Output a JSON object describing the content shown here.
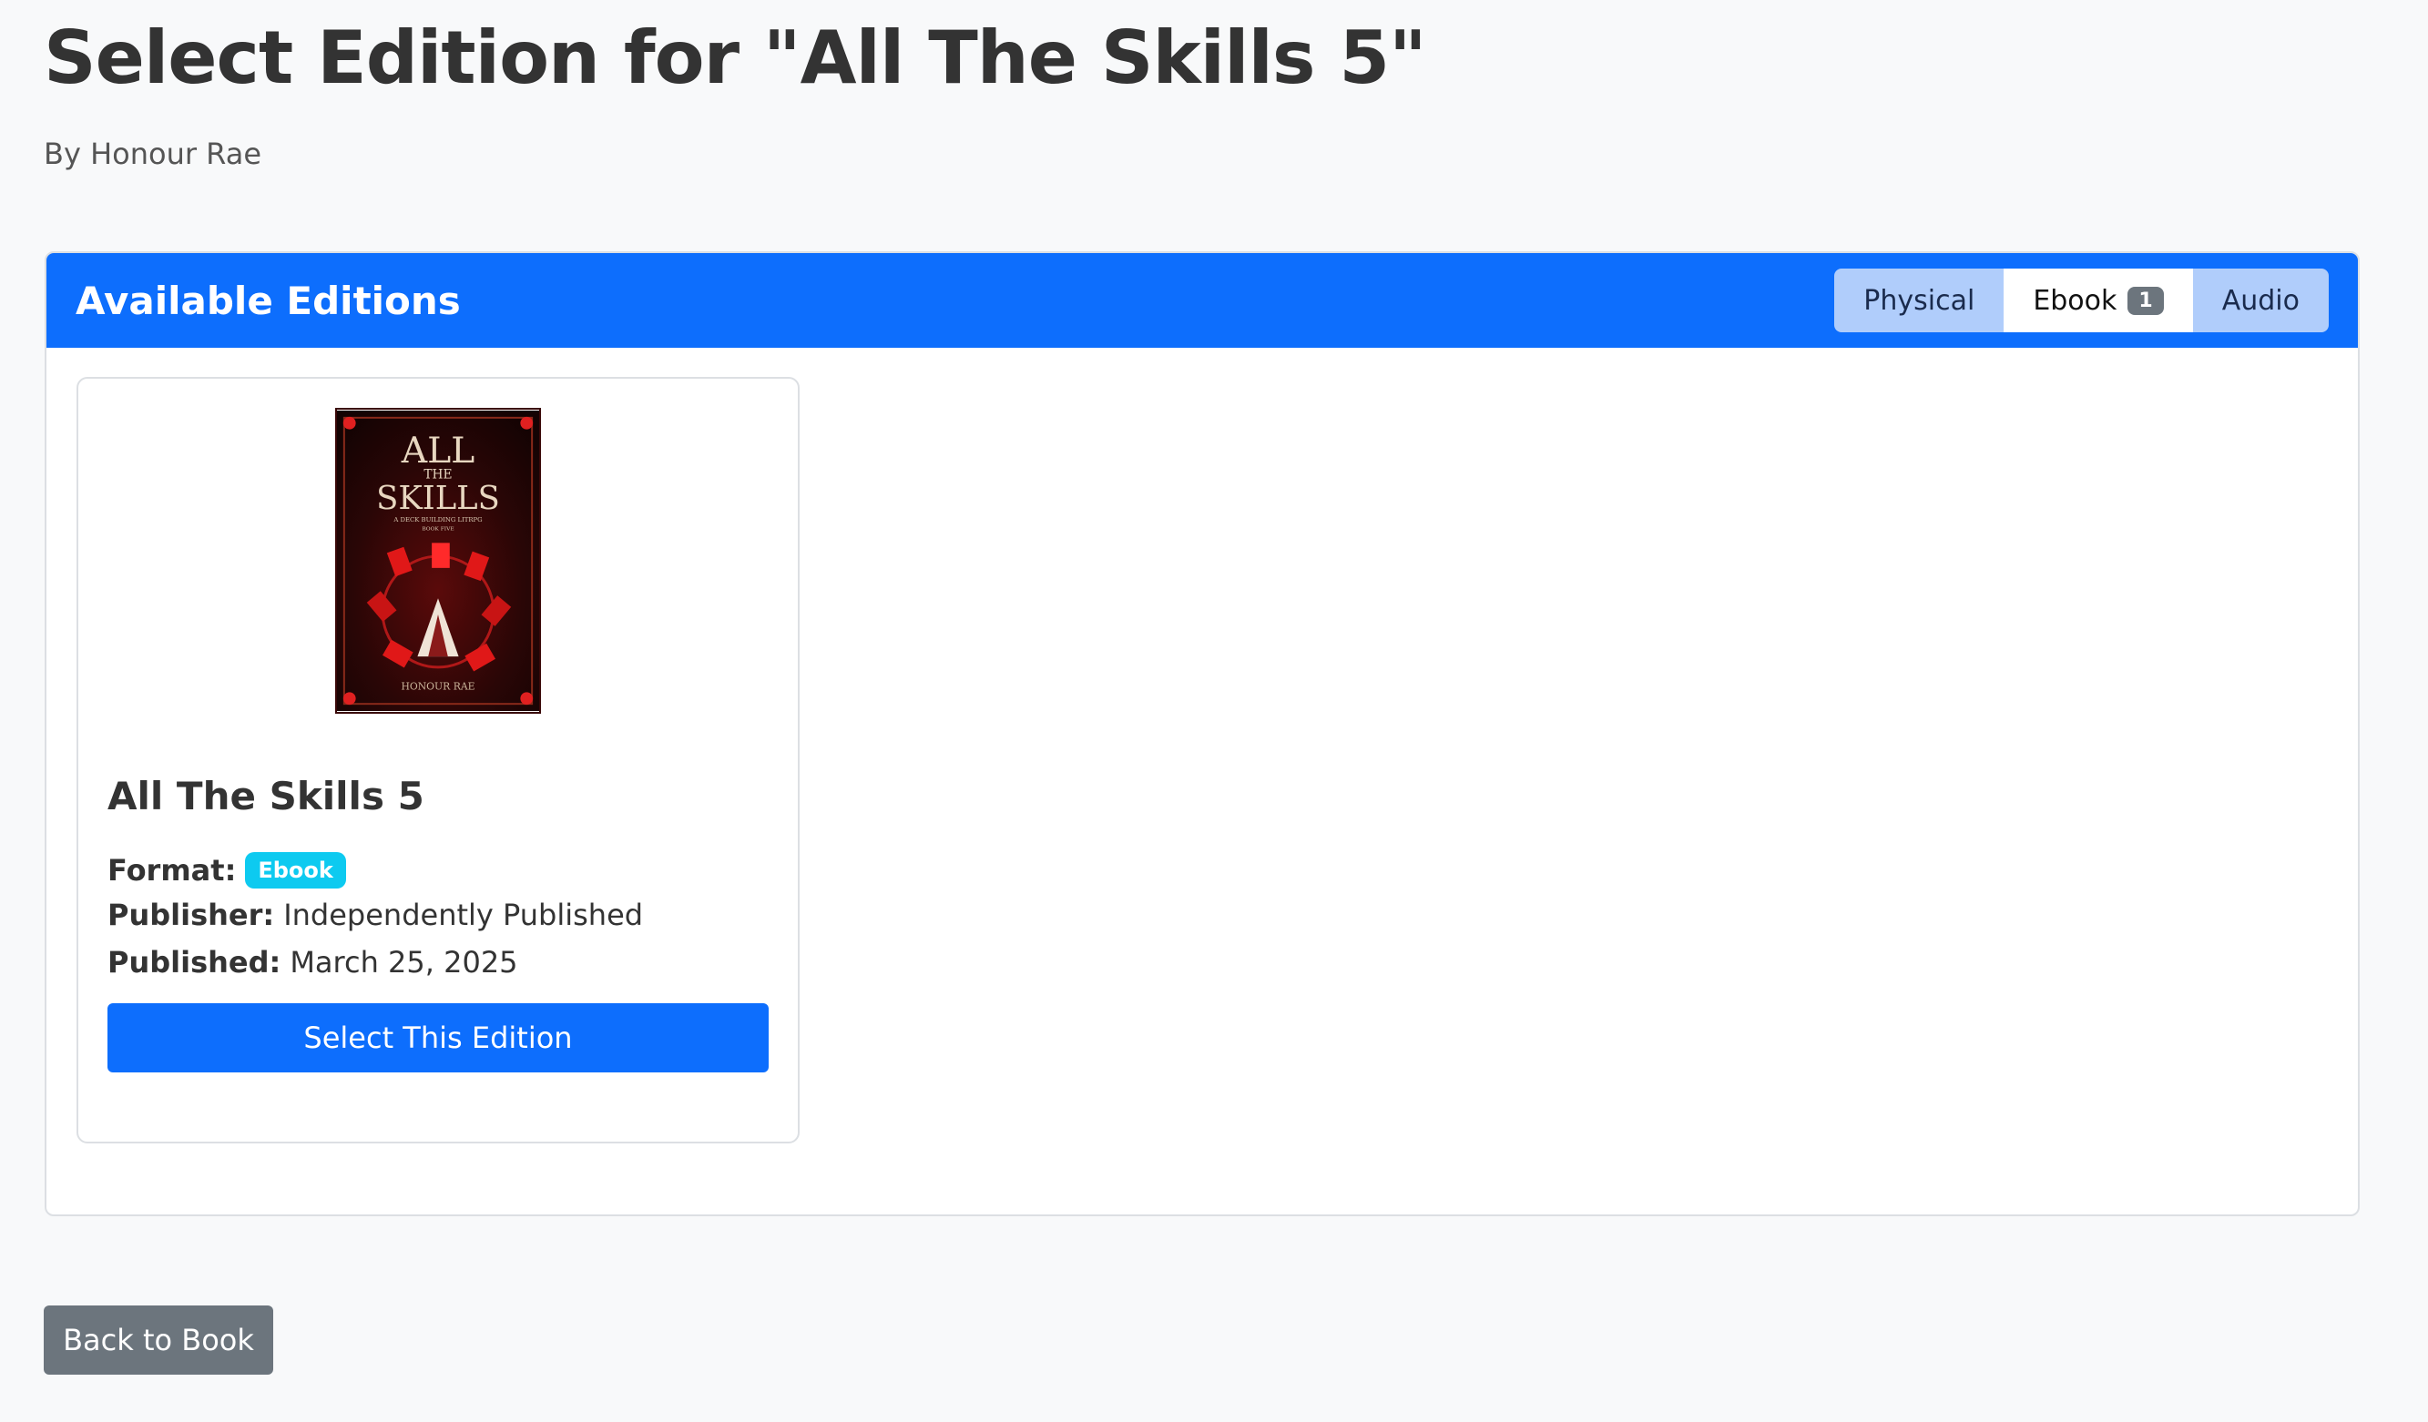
{
  "page": {
    "title": "Select Edition for \"All The Skills 5\"",
    "author_line": "By Honour Rae"
  },
  "panel": {
    "title": "Available Editions",
    "tabs": [
      {
        "label": "Physical",
        "active": false
      },
      {
        "label": "Ebook",
        "active": true,
        "count": "1"
      },
      {
        "label": "Audio",
        "active": false
      }
    ]
  },
  "edition": {
    "cover": {
      "title_top": "ALL",
      "title_mid": "THE",
      "title_main": "SKILLS",
      "subtitle": "A DECK BUILDING LITRPG",
      "book_number": "BOOK FIVE",
      "author": "HONOUR RAE"
    },
    "title": "All The Skills 5",
    "format_label": "Format:",
    "format_value": "Ebook",
    "publisher_label": "Publisher:",
    "publisher_value": "Independently Published",
    "published_label": "Published:",
    "published_value": "March 25, 2025",
    "select_label": "Select This Edition"
  },
  "footer": {
    "back_label": "Back to Book"
  },
  "colors": {
    "primary": "#0d6efd",
    "info": "#0dcaf0",
    "secondary": "#6c757d",
    "background": "#f8f9fa"
  }
}
